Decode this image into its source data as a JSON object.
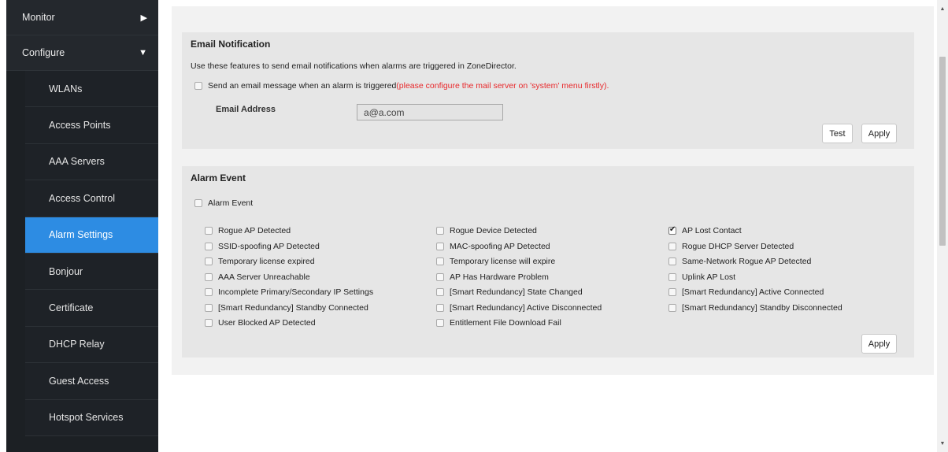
{
  "sidebar": {
    "top_items": [
      {
        "label": "Monitor",
        "arrow": "▶"
      },
      {
        "label": "Configure",
        "arrow": "▼"
      }
    ],
    "sub_items": [
      {
        "label": "WLANs"
      },
      {
        "label": "Access Points"
      },
      {
        "label": "AAA Servers"
      },
      {
        "label": "Access Control"
      },
      {
        "label": "Alarm Settings",
        "active": true
      },
      {
        "label": "Bonjour"
      },
      {
        "label": "Certificate"
      },
      {
        "label": "DHCP Relay"
      },
      {
        "label": "Guest Access"
      },
      {
        "label": "Hotspot Services"
      }
    ]
  },
  "email": {
    "title": "Email Notification",
    "description": "Use these features to send email notifications when alarms are triggered in ZoneDirector.",
    "send_label": "Send an email message when an alarm is triggered",
    "send_warning": "(please configure the mail server on 'system' menu firstly).",
    "send_checked": false,
    "address_label": "Email Address",
    "address_value": "a@a.com",
    "test_button": "Test",
    "apply_button": "Apply"
  },
  "alarm": {
    "title": "Alarm Event",
    "master_label": "Alarm Event",
    "apply_button": "Apply",
    "columns": [
      [
        {
          "label": "Rogue AP Detected",
          "checked": false
        },
        {
          "label": "SSID-spoofing AP Detected",
          "checked": false
        },
        {
          "label": "Temporary license expired",
          "checked": false
        },
        {
          "label": "AAA Server Unreachable",
          "checked": false
        },
        {
          "label": "Incomplete Primary/Secondary IP Settings",
          "checked": false
        },
        {
          "label": "[Smart Redundancy] Standby Connected",
          "checked": false
        },
        {
          "label": "User Blocked AP Detected",
          "checked": false
        }
      ],
      [
        {
          "label": "Rogue Device Detected",
          "checked": false
        },
        {
          "label": "MAC-spoofing AP Detected",
          "checked": false
        },
        {
          "label": "Temporary license will expire",
          "checked": false
        },
        {
          "label": "AP Has Hardware Problem",
          "checked": false
        },
        {
          "label": "[Smart Redundancy] State Changed",
          "checked": false
        },
        {
          "label": "[Smart Redundancy] Active Disconnected",
          "checked": false
        },
        {
          "label": "Entitlement File Download Fail",
          "checked": false
        }
      ],
      [
        {
          "label": "AP Lost Contact",
          "checked": true
        },
        {
          "label": "Rogue DHCP Server Detected",
          "checked": false
        },
        {
          "label": "Same-Network Rogue AP Detected",
          "checked": false
        },
        {
          "label": "Uplink AP Lost",
          "checked": false
        },
        {
          "label": "[Smart Redundancy] Active Connected",
          "checked": false
        },
        {
          "label": "[Smart Redundancy] Standby Disconnected",
          "checked": false
        }
      ]
    ]
  },
  "scrollbar": {
    "up_icon": "▲",
    "down_icon": "▼"
  }
}
